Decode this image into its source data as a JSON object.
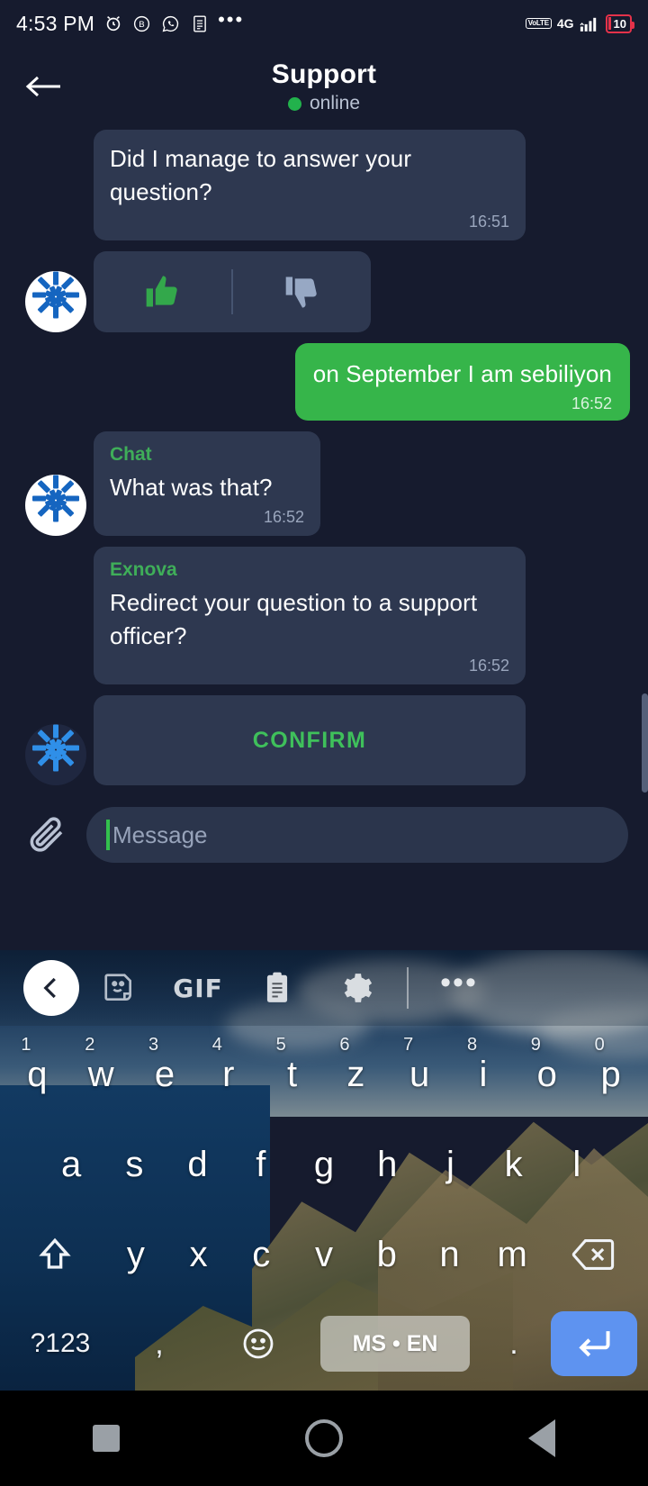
{
  "statusbar": {
    "time": "4:53 PM",
    "icons": [
      "alarm-icon",
      "b-badge-icon",
      "whatsapp-icon",
      "document-icon",
      "overflow-dots-icon"
    ],
    "volte": "VoLTE",
    "network": "4G",
    "battery_level": "10"
  },
  "header": {
    "back_icon": "back-arrow-icon",
    "title": "Support",
    "status": "online",
    "status_color": "#22b24c"
  },
  "chat": {
    "messages": [
      {
        "id": "m1",
        "direction": "in",
        "sender": "",
        "text": "Did I manage to answer your question?",
        "time": "16:51"
      },
      {
        "id": "m2",
        "direction": "in",
        "type": "rating",
        "thumbs_up_icon": "thumbs-up-icon",
        "thumbs_down_icon": "thumbs-down-icon",
        "thumbs_up_color": "#33a84b",
        "thumbs_down_color": "#97a8c4"
      },
      {
        "id": "m3",
        "direction": "out",
        "text": "on September I am sebiliyon",
        "time": "16:52"
      },
      {
        "id": "m4",
        "direction": "in",
        "sender": "Chat",
        "text": "What was that?",
        "time": "16:52"
      },
      {
        "id": "m5",
        "direction": "in",
        "sender": "Exnova",
        "text": "Redirect your question to a support officer?",
        "time": "16:52"
      },
      {
        "id": "m6",
        "direction": "in",
        "type": "action",
        "label": "CONFIRM"
      }
    ]
  },
  "input": {
    "attach_icon": "paperclip-icon",
    "placeholder": "Message",
    "value": ""
  },
  "keyboard": {
    "toolbar": {
      "back_icon": "chevron-left-icon",
      "items": [
        "sticker-icon",
        "GIF",
        "clipboard-icon",
        "gear-icon",
        "overflow-dots-icon"
      ],
      "gif_label": "GIF"
    },
    "row1": [
      {
        "key": "q",
        "num": "1"
      },
      {
        "key": "w",
        "num": "2"
      },
      {
        "key": "e",
        "num": "3"
      },
      {
        "key": "r",
        "num": "4"
      },
      {
        "key": "t",
        "num": "5"
      },
      {
        "key": "z",
        "num": "6"
      },
      {
        "key": "u",
        "num": "7"
      },
      {
        "key": "i",
        "num": "8"
      },
      {
        "key": "o",
        "num": "9"
      },
      {
        "key": "p",
        "num": "0"
      }
    ],
    "row2": [
      "a",
      "s",
      "d",
      "f",
      "g",
      "h",
      "j",
      "k",
      "l"
    ],
    "row3": [
      "y",
      "x",
      "c",
      "v",
      "b",
      "n",
      "m"
    ],
    "shift_icon": "shift-icon",
    "backspace_icon": "backspace-icon",
    "symbols_label": "?123",
    "comma_label": ",",
    "emoji_icon": "emoji-icon",
    "space_label": "MS • EN",
    "period_label": ".",
    "enter_icon": "enter-icon"
  },
  "navbar": {
    "recents_icon": "square-recents-icon",
    "home_icon": "circle-home-icon",
    "back_icon": "triangle-back-icon"
  }
}
